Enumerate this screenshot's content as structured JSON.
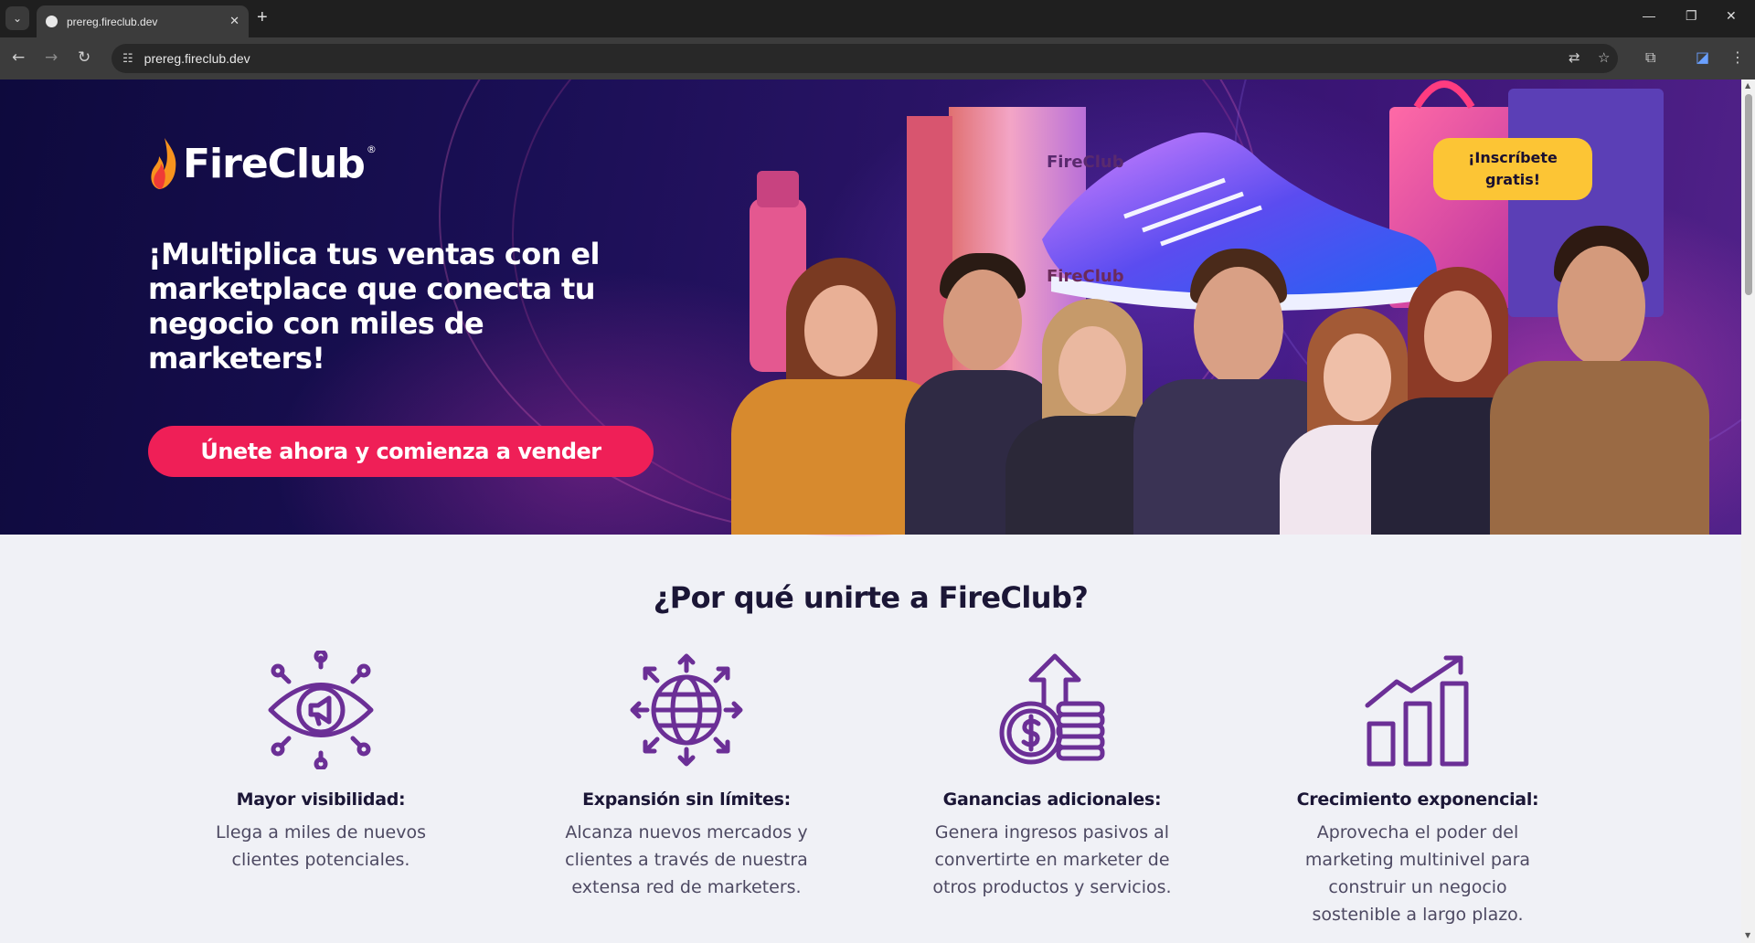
{
  "browser": {
    "tab_title": "prereg.fireclub.dev",
    "url": "prereg.fireclub.dev"
  },
  "hero": {
    "logo_text": "FireClub",
    "logo_mark": "®",
    "headline": "¡Multiplica tus ventas con el marketplace que conecta tu negocio con miles de marketers!",
    "cta_label": "Únete ahora y comienza a vender",
    "signup_label": "¡Inscríbete gratis!",
    "box_label_1": "FireClub",
    "box_label_2": "FireClub"
  },
  "why": {
    "title": "¿Por qué unirte a FireClub?",
    "features": [
      {
        "icon": "eye-megaphone-icon",
        "title": "Mayor visibilidad:",
        "text": "Llega a miles de nuevos clientes potenciales."
      },
      {
        "icon": "globe-arrows-icon",
        "title": "Expansión sin límites:",
        "text": "Alcanza nuevos mercados y clientes a través de nuestra extensa red de marketers."
      },
      {
        "icon": "coin-stack-arrow-icon",
        "title": "Ganancias adicionales:",
        "text": "Genera ingresos pasivos al convertirte en marketer de otros productos y servicios."
      },
      {
        "icon": "growth-chart-icon",
        "title": "Crecimiento exponencial:",
        "text": "Aprovecha el poder del marketing multinivel para construir un negocio sostenible a largo plazo."
      }
    ]
  },
  "colors": {
    "accent_purple": "#6b2f96",
    "cta_pink": "#ef1f57",
    "signup_yellow": "#fcc535"
  }
}
